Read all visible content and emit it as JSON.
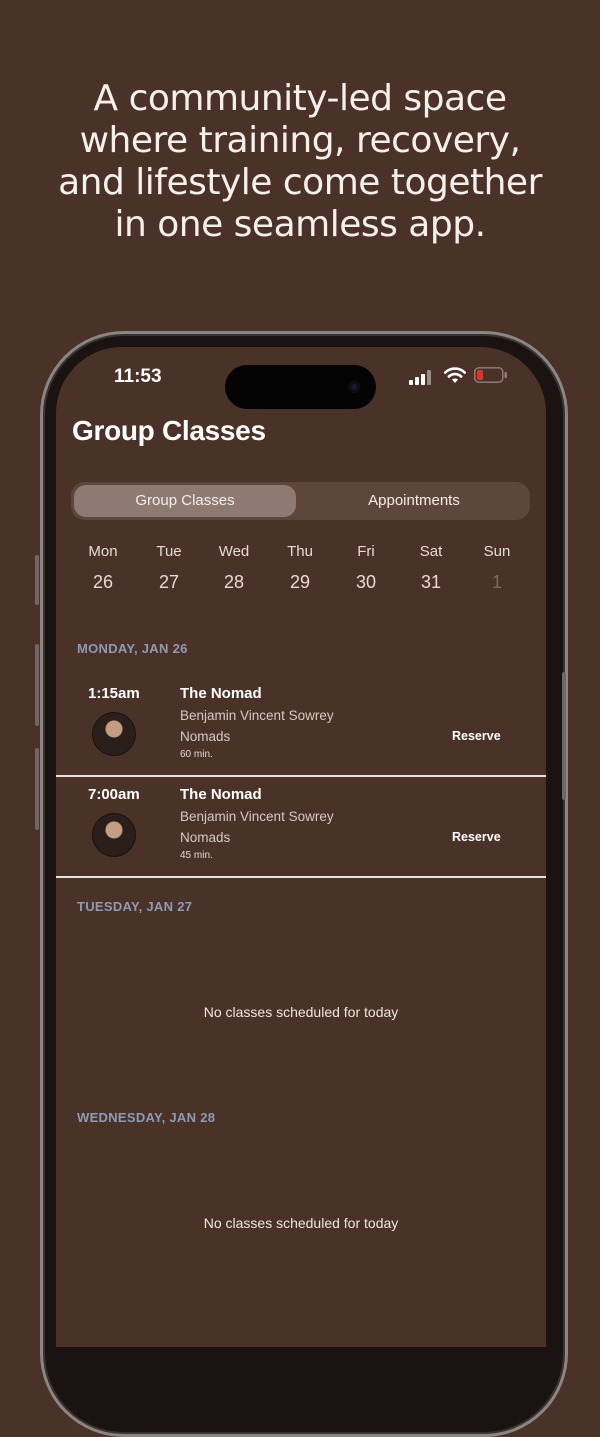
{
  "headline": {
    "line1": "A community-led space",
    "line2": "where training, recovery,",
    "line3": "and lifestyle come together",
    "line4": "in one seamless app."
  },
  "status_bar": {
    "time": "11:53",
    "icons": [
      "cellular-signal-icon",
      "wifi-icon",
      "battery-low-icon"
    ],
    "battery_color": "#e0342b"
  },
  "page_title": "Group Classes",
  "segments": {
    "active": "Group Classes",
    "inactive": "Appointments"
  },
  "week": [
    {
      "name": "Mon",
      "date": "26"
    },
    {
      "name": "Tue",
      "date": "27"
    },
    {
      "name": "Wed",
      "date": "28"
    },
    {
      "name": "Thu",
      "date": "29"
    },
    {
      "name": "Fri",
      "date": "30"
    },
    {
      "name": "Sat",
      "date": "31"
    },
    {
      "name": "Sun",
      "date": "1"
    }
  ],
  "days": [
    {
      "label": "MONDAY, JAN 26",
      "classes": [
        {
          "time": "1:15am",
          "title": "The Nomad",
          "instructor": "Benjamin Vincent Sowrey",
          "location": "Nomads",
          "duration": "60 min.",
          "action": "Reserve"
        },
        {
          "time": "7:00am",
          "title": "The Nomad",
          "instructor": "Benjamin Vincent Sowrey",
          "location": "Nomads",
          "duration": "45 min.",
          "action": "Reserve"
        }
      ]
    },
    {
      "label": "TUESDAY, JAN 27",
      "empty_text": "No classes scheduled for today"
    },
    {
      "label": "WEDNESDAY, JAN 28",
      "empty_text": "No classes scheduled for today"
    }
  ],
  "colors": {
    "background": "#4b3228",
    "section_label": "#8e9bb3",
    "segment_active": "#8e7a72"
  }
}
